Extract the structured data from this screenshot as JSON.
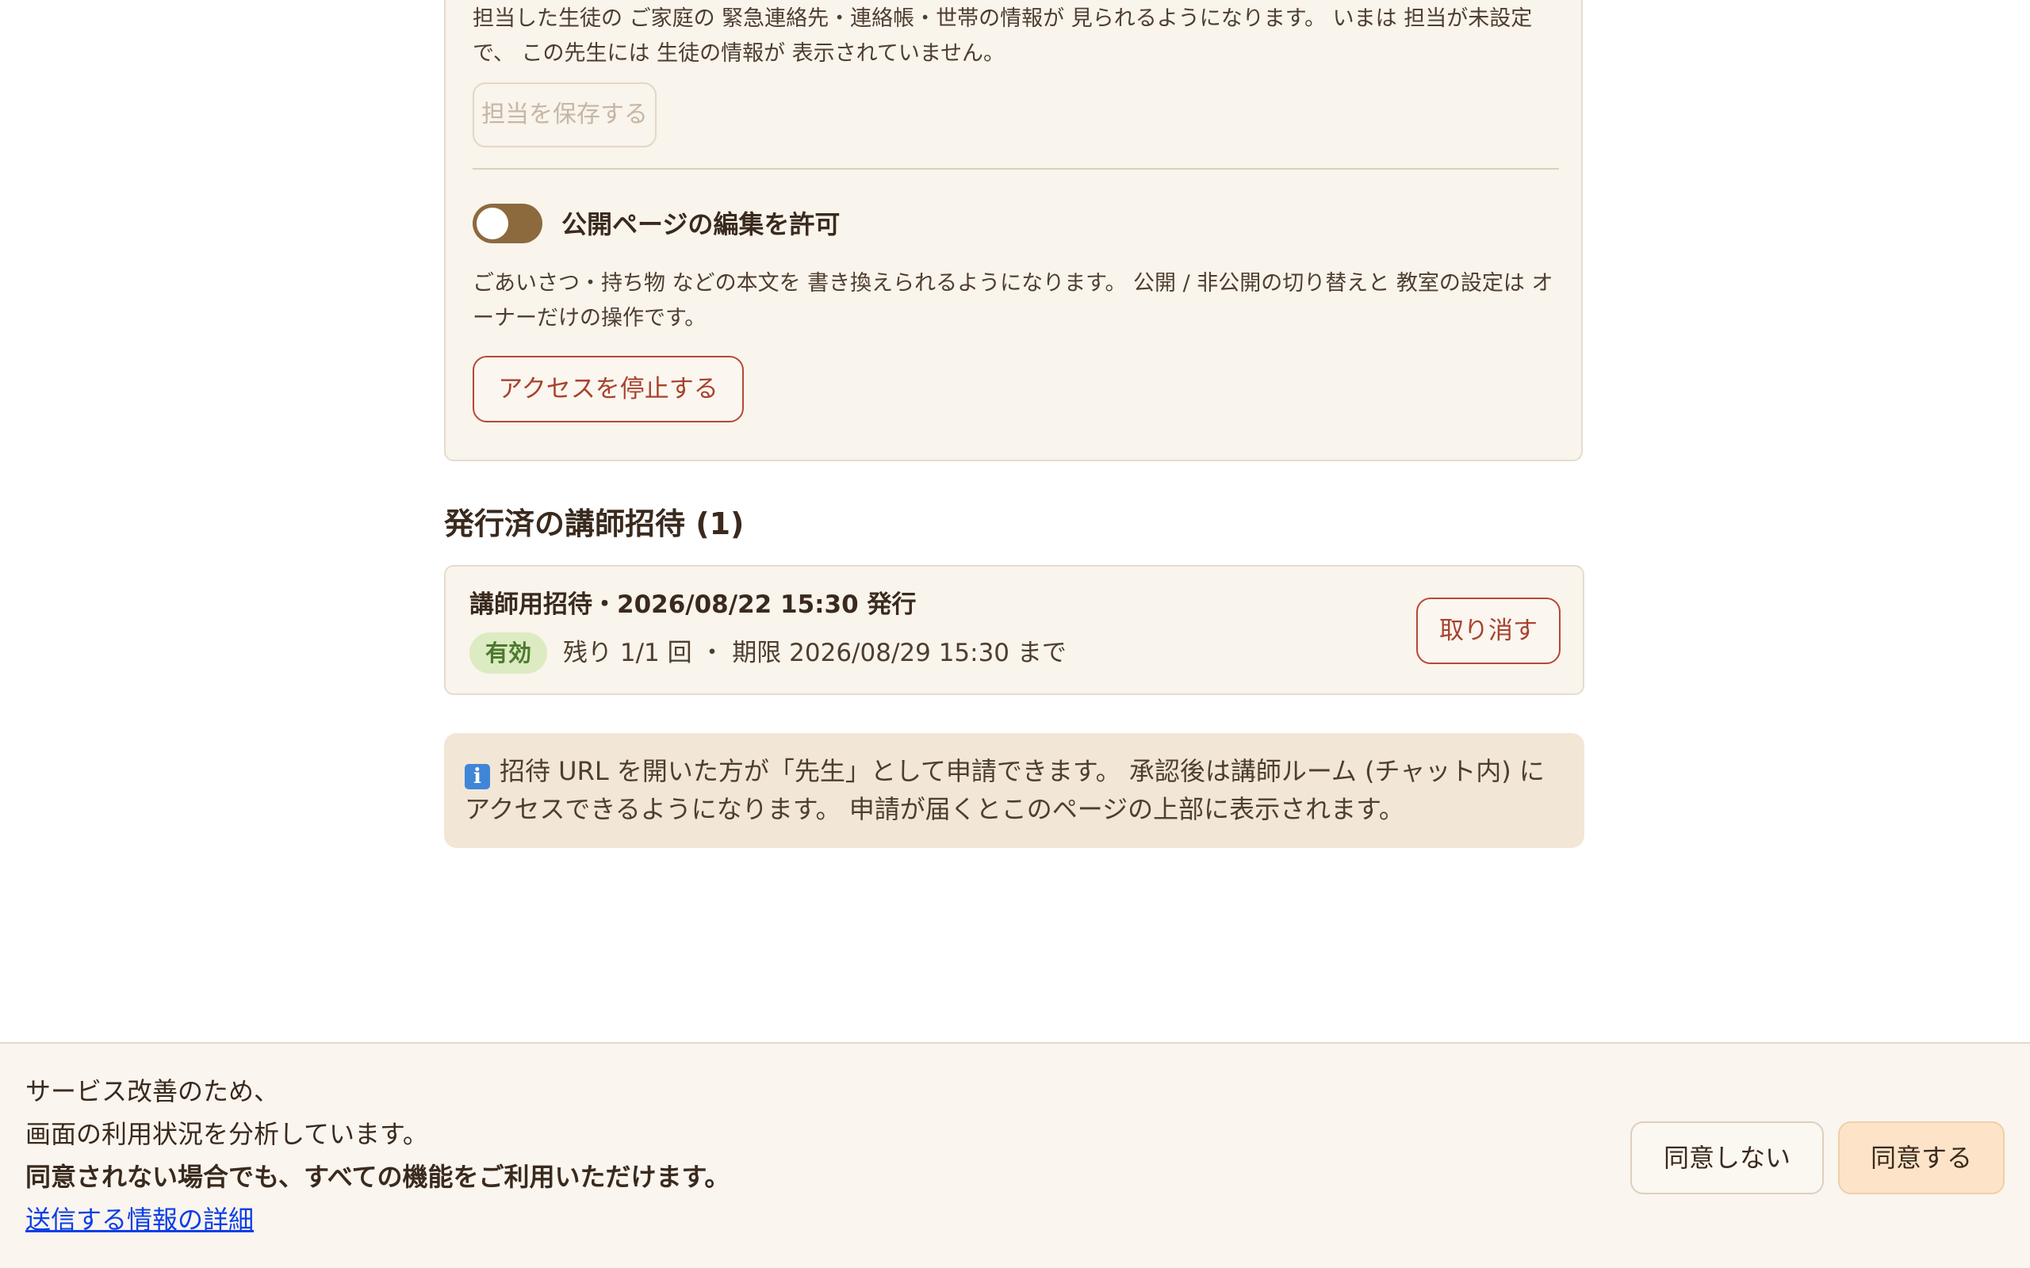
{
  "teacher_settings": {
    "assignment_description": "担当した生徒の ご家庭の 緊急連絡先・連絡帳・世帯の情報が 見られるようになります。 いまは 担当が未設定で、 この先生には 生徒の情報が 表示されていません。",
    "save_assignment_label": "担当を保存する",
    "edit_permission_label": "公開ページの編集を許可",
    "edit_permission_enabled": true,
    "edit_permission_description": "ごあいさつ・持ち物 などの本文を 書き換えられるようになります。 公開 / 非公開の切り替えと 教室の設定は オーナーだけの操作です。",
    "stop_access_label": "アクセスを停止する"
  },
  "invites_section": {
    "title": "発行済の講師招待 (1)",
    "items": [
      {
        "title": "講師用招待・2026/08/22 15:30 発行",
        "status": "有効",
        "meta": "残り 1/1 回 ・ 期限 2026/08/29 15:30 まで",
        "cancel_label": "取り消す"
      }
    ]
  },
  "info_note": {
    "icon": "info-icon",
    "icon_glyph": "i",
    "text": "招待 URL を開いた方が「先生」として申請できます。 承認後は講師ルーム (チャット内) にアクセスできるようになります。 申請が届くとこのページの上部に表示されます。"
  },
  "consent_banner": {
    "line1": "サービス改善のため、",
    "line2": "画面の利用状況を分析しています。",
    "line3": "同意されない場合でも、すべての機能をご利用いただけます。",
    "details_link": "送信する情報の詳細",
    "decline_label": "同意しない",
    "accept_label": "同意する"
  },
  "colors": {
    "card_background": "#f9f4ec",
    "toggle_on": "#8c6a3e",
    "danger_outline": "#b5483a",
    "badge_background": "#dcebc2",
    "badge_text": "#4d7a2e",
    "info_background": "#f2e6d6",
    "accept_background": "#fde4c9",
    "link": "#0a3ee6"
  }
}
